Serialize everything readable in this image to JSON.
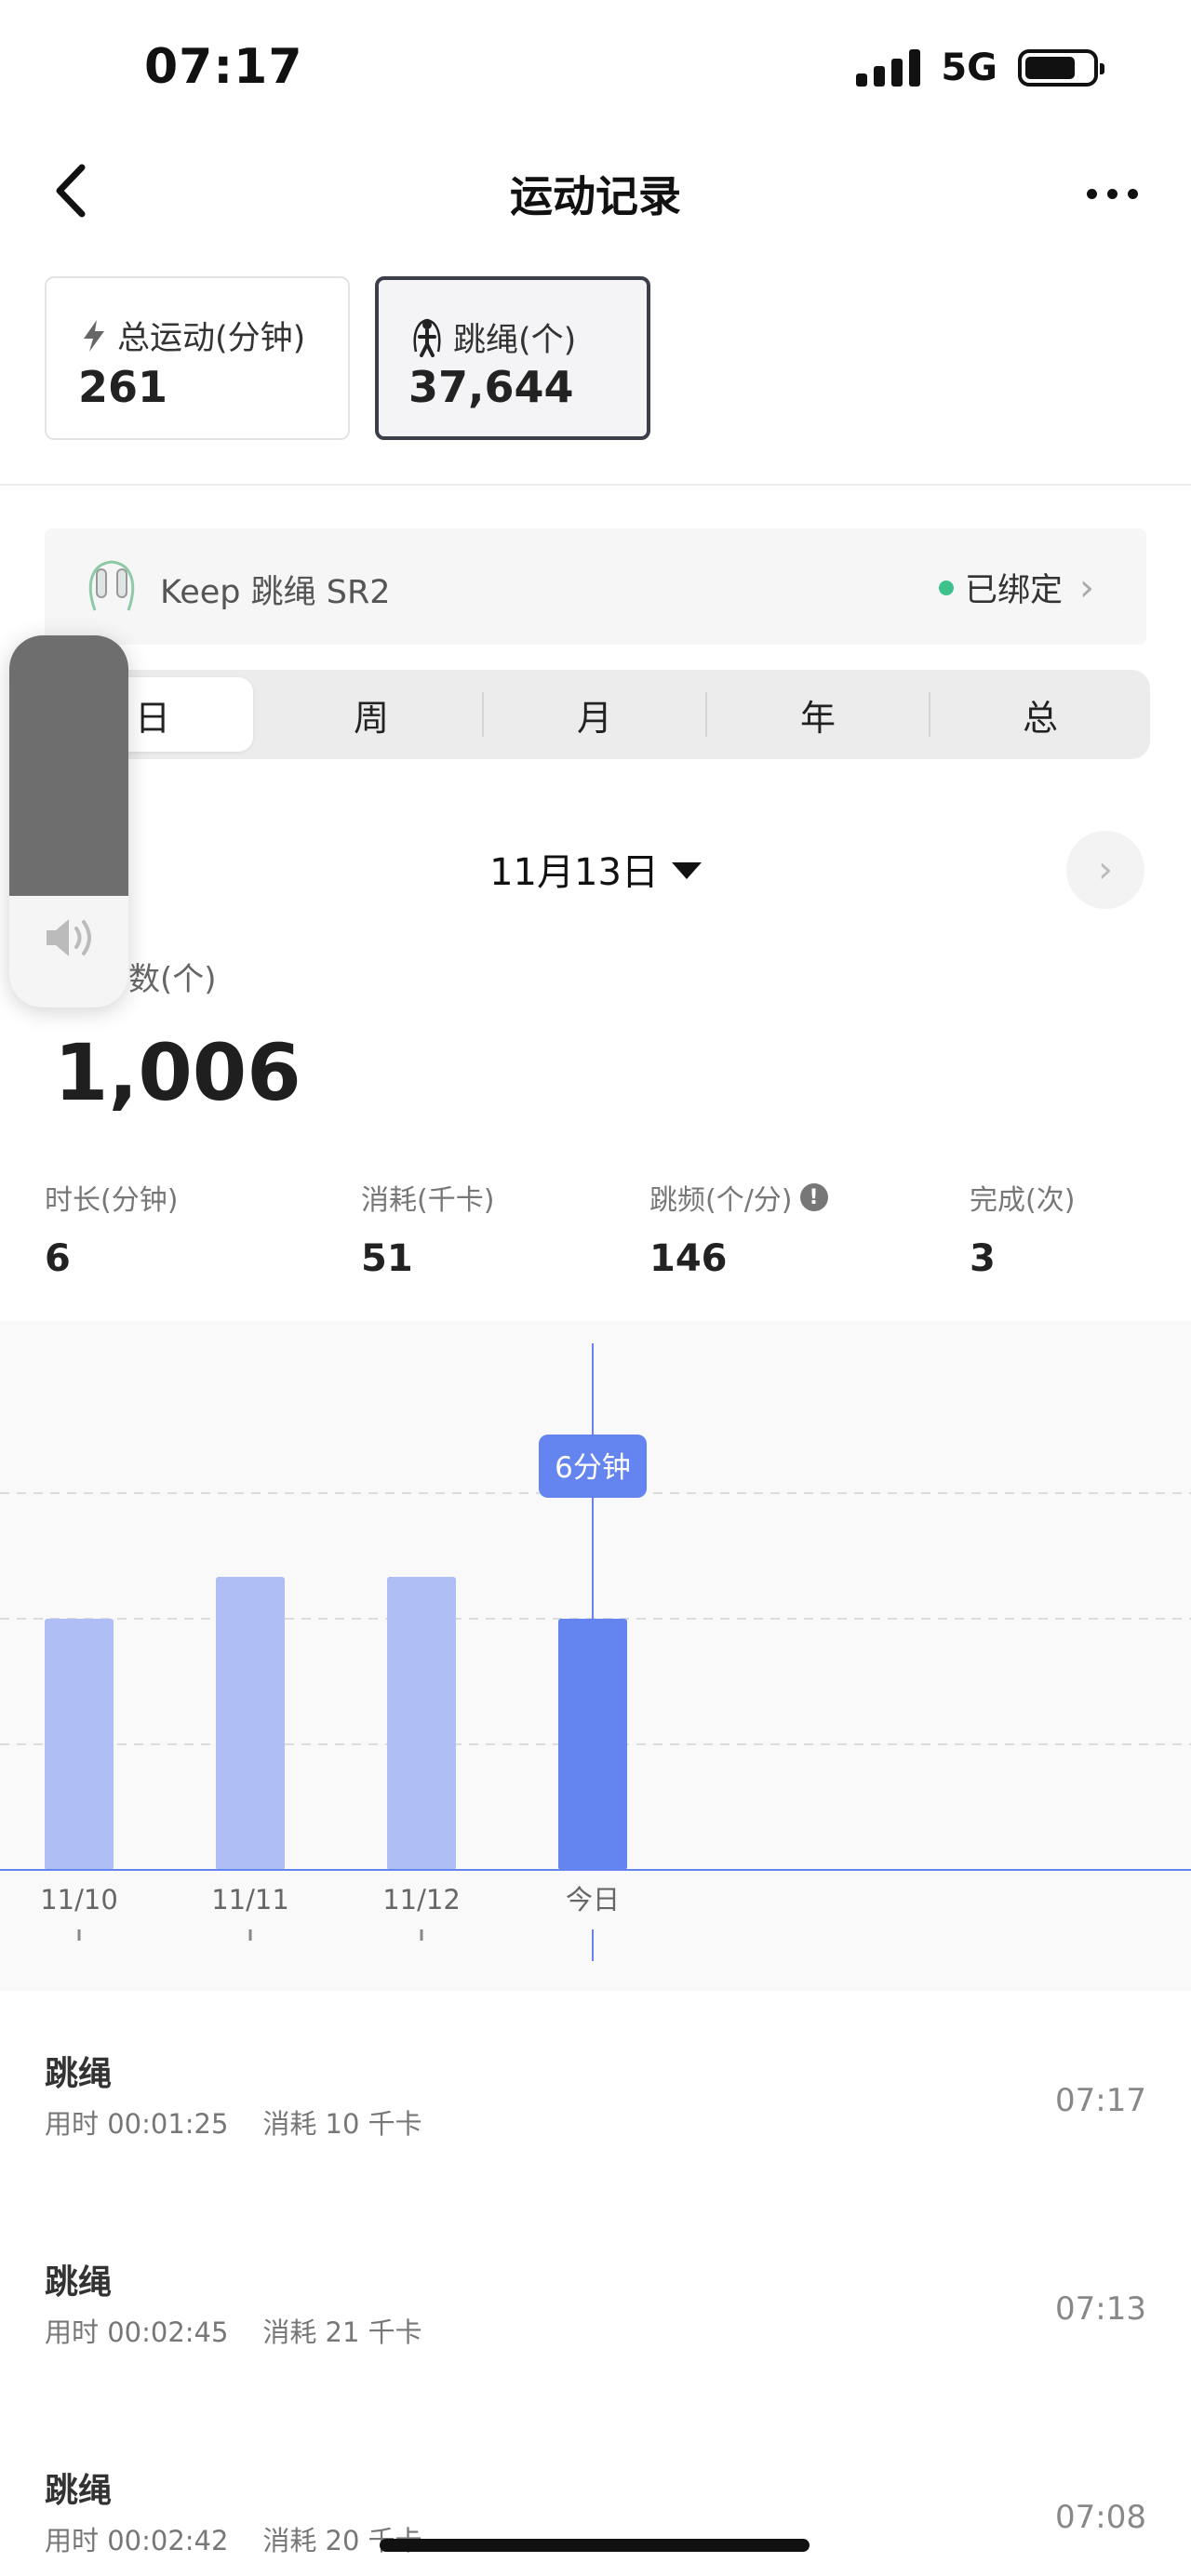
{
  "status_bar": {
    "time": "07:17",
    "network": "5G",
    "battery_level": 0.75
  },
  "nav": {
    "title": "运动记录"
  },
  "summary_cards": [
    {
      "label": "总运动(分钟)",
      "value": "261",
      "icon": "lightning-icon"
    },
    {
      "label": "跳绳(个)",
      "value": "37,644",
      "icon": "jump-rope-person-icon"
    }
  ],
  "device": {
    "name": "Keep 跳绳 SR2",
    "status": "已绑定",
    "status_color": "#3cc28a"
  },
  "period_tabs": {
    "items": [
      "日",
      "周",
      "月",
      "年",
      "总"
    ],
    "active": "日"
  },
  "volume_overlay": {
    "level": 0.3
  },
  "date_selector": {
    "label": "11月13日"
  },
  "main_metric": {
    "label": "数(个)",
    "value": "1,006"
  },
  "sub_metrics": [
    {
      "label": "时长(分钟)",
      "value": "6"
    },
    {
      "label": "消耗(千卡)",
      "value": "51"
    },
    {
      "label": "跳频(个/分)",
      "value": "146",
      "info_icon": "!"
    },
    {
      "label": "完成(次)",
      "value": "3"
    }
  ],
  "chart_data": {
    "type": "bar",
    "categories": [
      "11/10",
      "11/11",
      "11/12",
      "今日"
    ],
    "values": [
      6,
      7,
      7,
      6
    ],
    "ylim": [
      0,
      12
    ],
    "gridlines": [
      3,
      6,
      9
    ],
    "selected_index": 3,
    "tooltip": "6分钟",
    "bar_color": "#afbff5",
    "selected_color": "#6484ef",
    "axis_color": "#6484ef"
  },
  "records": [
    {
      "title": "跳绳",
      "duration": "用时 00:01:25",
      "calories": "消耗 10 千卡",
      "time": "07:17"
    },
    {
      "title": "跳绳",
      "duration": "用时 00:02:45",
      "calories": "消耗 21 千卡",
      "time": "07:13"
    },
    {
      "title": "跳绳",
      "duration": "用时 00:02:42",
      "calories": "消耗 20 千卡",
      "time": "07:08"
    }
  ]
}
